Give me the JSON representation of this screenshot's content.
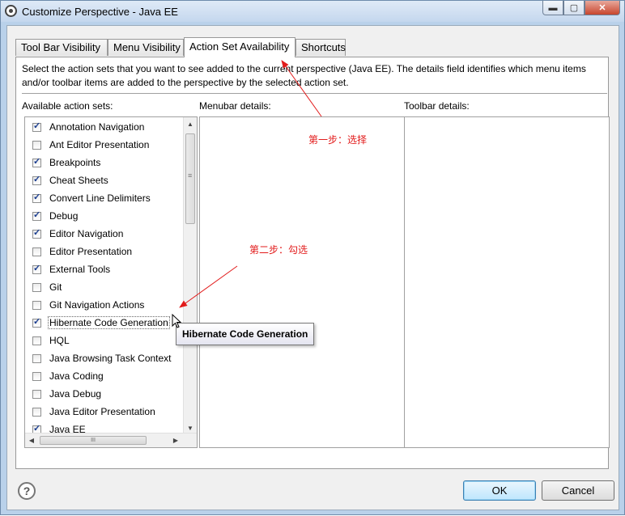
{
  "window": {
    "title": "Customize Perspective - Java EE",
    "minimize_glyph": "▬",
    "maximize_glyph": "▢",
    "close_glyph": "✕"
  },
  "tabs": [
    {
      "label": "Tool Bar Visibility",
      "active": false
    },
    {
      "label": "Menu Visibility",
      "active": false
    },
    {
      "label": "Action Set Availability",
      "active": true
    },
    {
      "label": "Shortcuts",
      "active": false
    }
  ],
  "panel": {
    "description": "Select the action sets that you want to see added to the current perspective (Java EE).  The details field identifies which menu items and/or toolbar items are added to the perspective by the selected action set.",
    "available_label": "Available action sets:",
    "menubar_label": "Menubar details:",
    "toolbar_label": "Toolbar details:"
  },
  "action_sets": [
    {
      "label": "Annotation Navigation",
      "checked": true
    },
    {
      "label": "Ant Editor Presentation",
      "checked": false
    },
    {
      "label": "Breakpoints",
      "checked": true
    },
    {
      "label": "Cheat Sheets",
      "checked": true
    },
    {
      "label": "Convert Line Delimiters",
      "checked": true
    },
    {
      "label": "Debug",
      "checked": true
    },
    {
      "label": "Editor Navigation",
      "checked": true
    },
    {
      "label": "Editor Presentation",
      "checked": false
    },
    {
      "label": "External Tools",
      "checked": true
    },
    {
      "label": "Git",
      "checked": false
    },
    {
      "label": "Git Navigation Actions",
      "checked": false
    },
    {
      "label": "Hibernate Code Generation",
      "checked": true,
      "focused": true
    },
    {
      "label": "HQL",
      "checked": false
    },
    {
      "label": "Java Browsing Task Context",
      "checked": false
    },
    {
      "label": "Java Coding",
      "checked": false
    },
    {
      "label": "Java Debug",
      "checked": false
    },
    {
      "label": "Java Editor Presentation",
      "checked": false
    },
    {
      "label": "Java EE",
      "checked": true
    }
  ],
  "scroll": {
    "up_glyph": "▲",
    "down_glyph": "▼",
    "left_glyph": "◀",
    "right_glyph": "▶",
    "v_grip": "≡",
    "h_grip": "III"
  },
  "tooltip": "Hibernate Code Generation",
  "annotations": {
    "step1": "第一步：选择",
    "step2": "第二步：勾选",
    "color": "#e21b1b"
  },
  "buttons": {
    "help_glyph": "?",
    "ok_label": "OK",
    "cancel_label": "Cancel"
  }
}
